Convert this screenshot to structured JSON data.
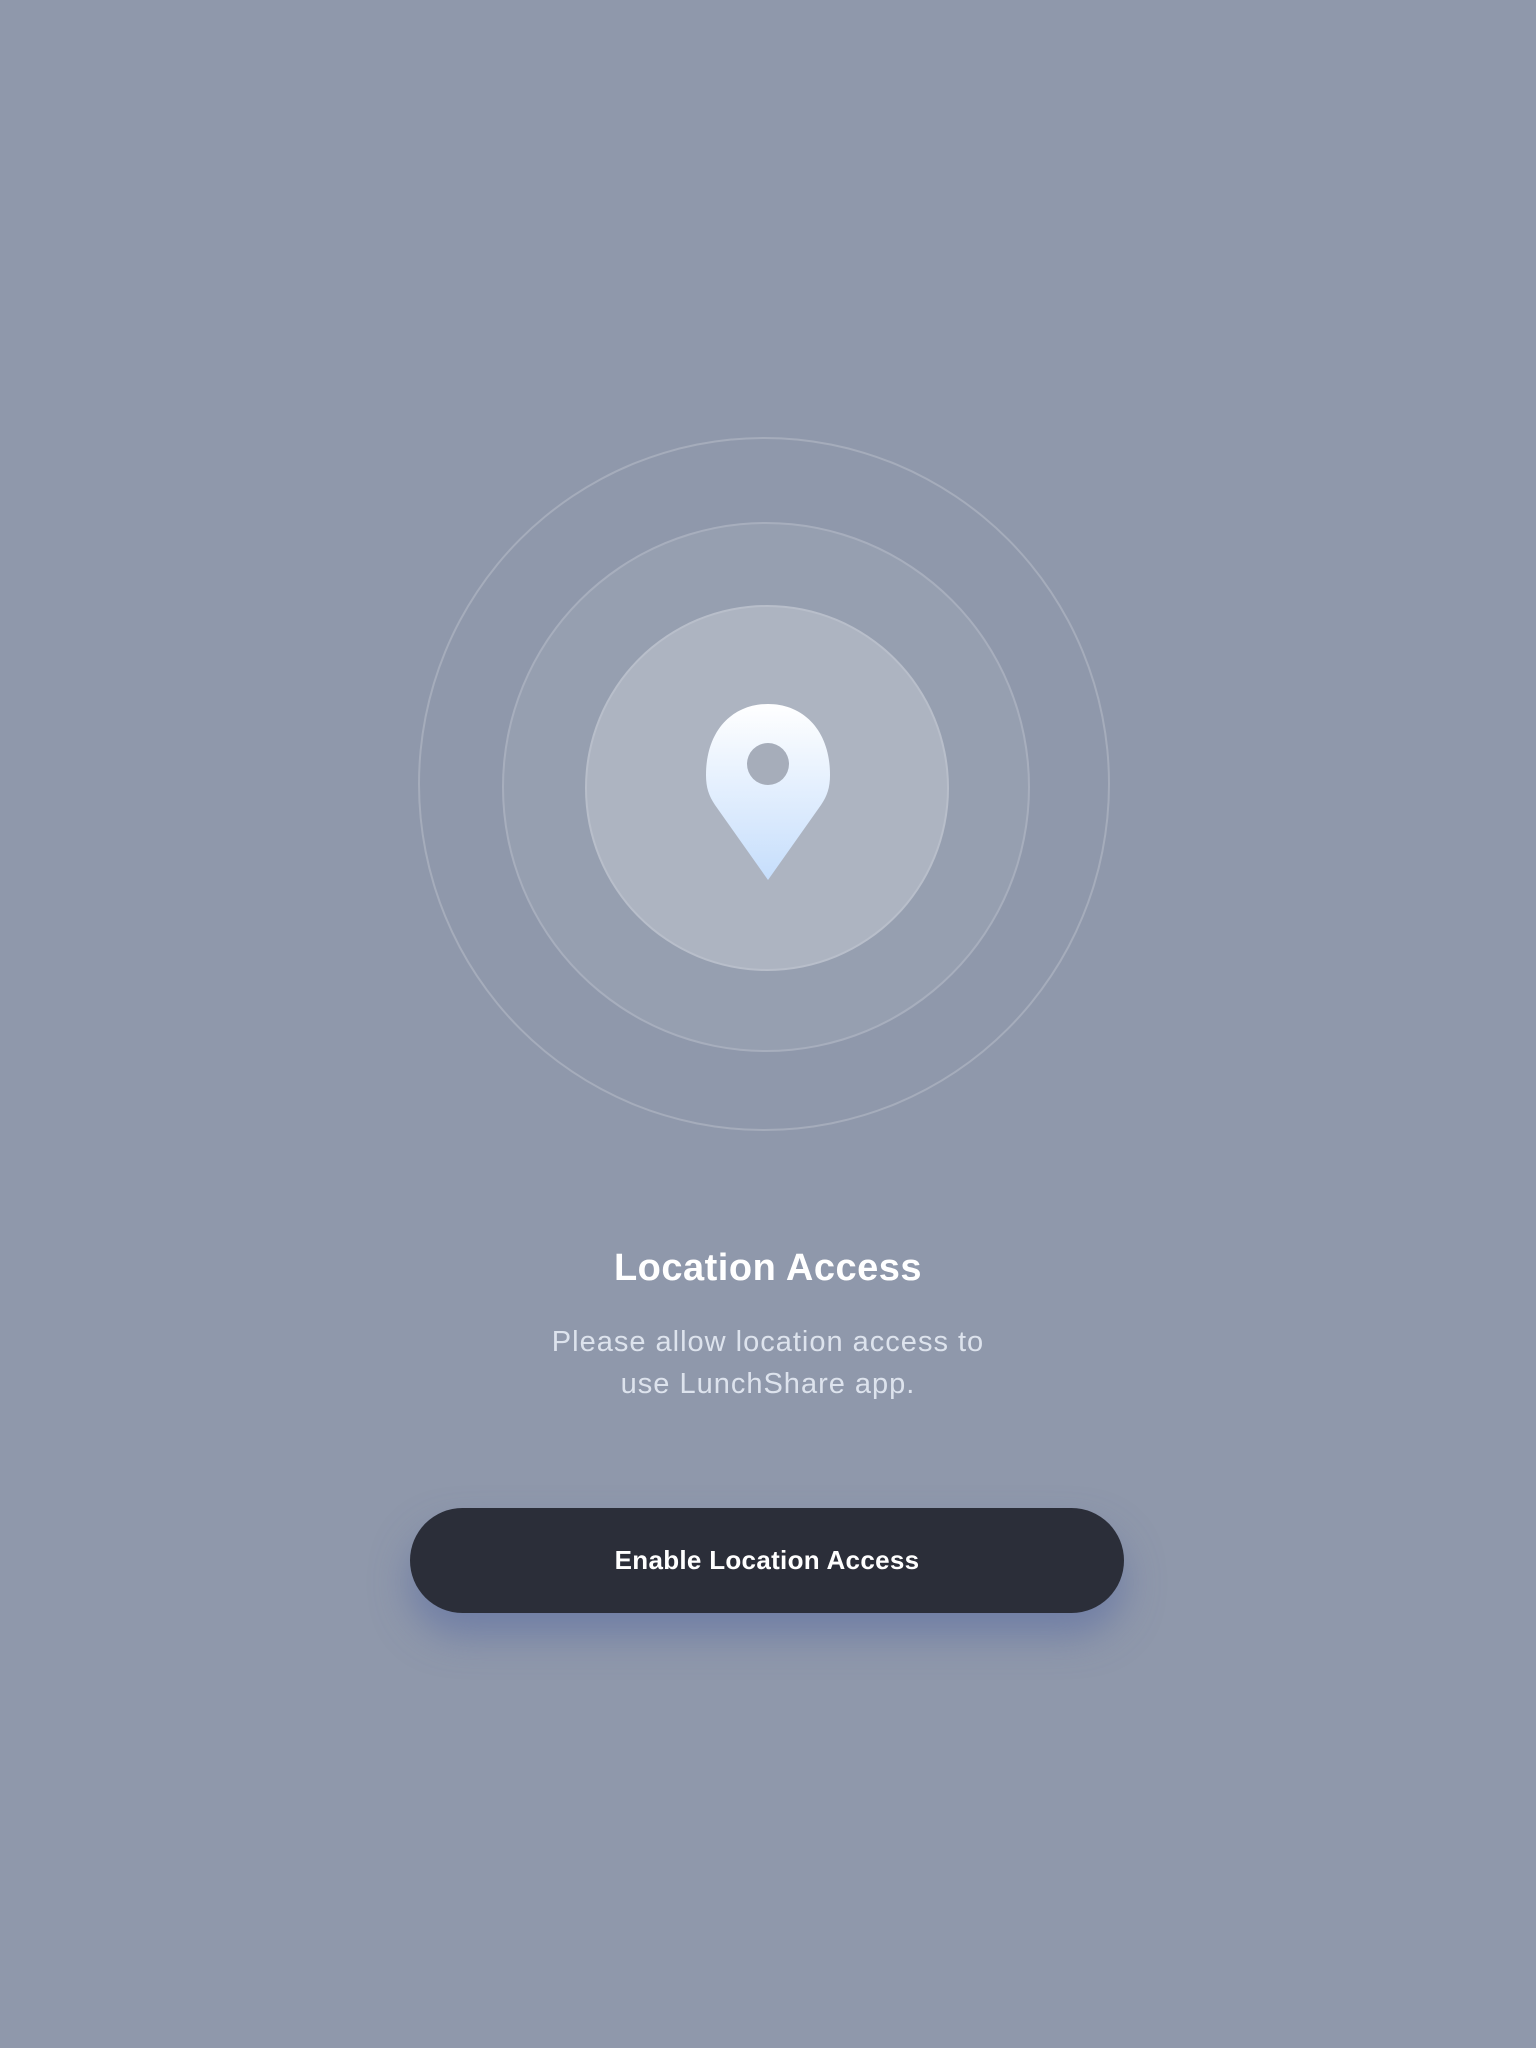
{
  "permission_screen": {
    "title": "Location Access",
    "subtitle": "Please allow location access to\nuse LunchShare app.",
    "button_label": "Enable Location Access",
    "icon": "location-pin-icon"
  },
  "colors": {
    "background": "#8f98ab",
    "button": "#2b2e39",
    "pin_top": "#ffffff",
    "pin_bottom": "#c6defc"
  }
}
